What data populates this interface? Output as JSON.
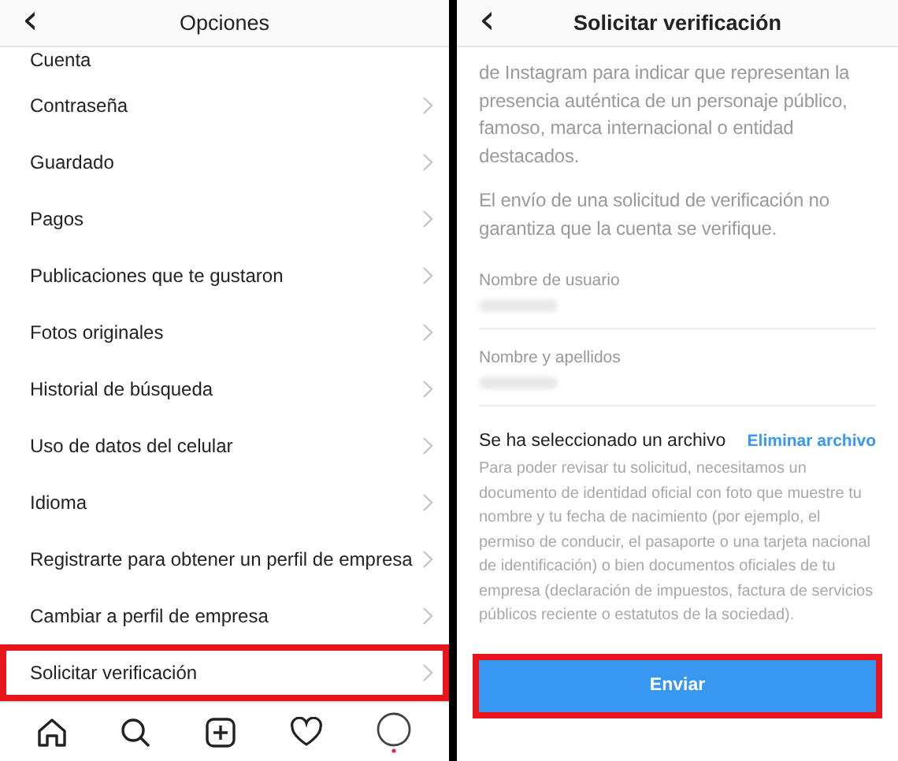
{
  "left": {
    "header": {
      "back": "‹",
      "title": "Opciones"
    },
    "section": "Cuenta",
    "items": [
      {
        "label": "Contraseña",
        "highlighted": false
      },
      {
        "label": "Guardado",
        "highlighted": false
      },
      {
        "label": "Pagos",
        "highlighted": false
      },
      {
        "label": "Publicaciones que te gustaron",
        "highlighted": false
      },
      {
        "label": "Fotos originales",
        "highlighted": false
      },
      {
        "label": "Historial de búsqueda",
        "highlighted": false
      },
      {
        "label": "Uso de datos del celular",
        "highlighted": false
      },
      {
        "label": "Idioma",
        "highlighted": false
      },
      {
        "label": "Registrarte para obtener un perfil de empresa",
        "highlighted": false
      },
      {
        "label": "Cambiar a perfil de empresa",
        "highlighted": false
      },
      {
        "label": "Solicitar verificación",
        "highlighted": true
      }
    ],
    "tab_bar": [
      {
        "kind": "home"
      },
      {
        "kind": "search"
      },
      {
        "kind": "add"
      },
      {
        "kind": "heart"
      },
      {
        "kind": "profile"
      }
    ]
  },
  "right": {
    "header": {
      "back": "‹",
      "title": "Solicitar verificación"
    },
    "intro": "de Instagram para indicar que representan la presencia auténtica de un personaje público, famoso, marca internacional o entidad destacados.",
    "notice": "El envío de una solicitud de verificación no garantiza que la cuenta se verifique.",
    "fields": [
      {
        "label": "Nombre de usuario"
      },
      {
        "label": "Nombre y apellidos"
      }
    ],
    "file_status": "Se ha seleccionado un archivo",
    "remove_link": "Eliminar archivo",
    "help": "Para poder revisar tu solicitud, necesitamos un documento de identidad oficial con foto que muestre tu nombre y tu fecha de nacimiento (por ejemplo, el permiso de conducir, el pasaporte o una tarjeta nacional de identificación) o bien documentos oficiales de tu empresa (declaración de impuestos, factura de servicios públicos reciente o estatutos de la sociedad).",
    "submit": {
      "label": "Enviar",
      "highlighted": true
    }
  }
}
